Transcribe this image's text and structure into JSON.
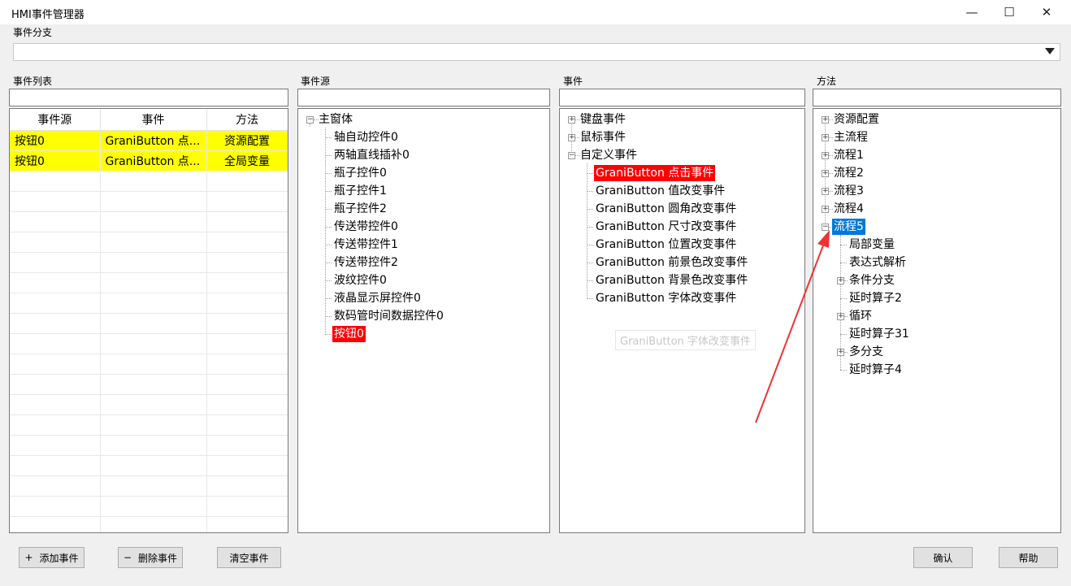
{
  "window": {
    "title": "HMI事件管理器",
    "minimize": "—",
    "maximize": "☐",
    "close": "✕"
  },
  "branch": {
    "label": "事件分支",
    "value": ""
  },
  "event_list": {
    "label": "事件列表",
    "columns": [
      "事件源",
      "事件",
      "方法"
    ],
    "rows": [
      {
        "source": "按钮0",
        "event": "GraniButton 点...",
        "method": "资源配置"
      },
      {
        "source": "按钮0",
        "event": "GraniButton 点...",
        "method": "全局变量"
      }
    ]
  },
  "event_source": {
    "label": "事件源",
    "root": "主窗体",
    "items": [
      "轴自动控件0",
      "两轴直线插补0",
      "瓶子控件0",
      "瓶子控件1",
      "瓶子控件2",
      "传送带控件0",
      "传送带控件1",
      "传送带控件2",
      "波纹控件0",
      "液晶显示屏控件0",
      "数码管时间数据控件0",
      "按钮0"
    ]
  },
  "events": {
    "label": "事件",
    "groups": [
      "键盘事件",
      "鼠标事件",
      "自定义事件"
    ],
    "custom_items": [
      "GraniButton 点击事件",
      "GraniButton 值改变事件",
      "GraniButton 圆角改变事件",
      "GraniButton 尺寸改变事件",
      "GraniButton 位置改变事件",
      "GraniButton 前景色改变事件",
      "GraniButton 背景色改变事件",
      "GraniButton 字体改变事件"
    ],
    "tooltip": "GraniButton 字体改变事件"
  },
  "methods": {
    "label": "方法",
    "top_items": [
      "资源配置",
      "主流程",
      "流程1",
      "流程2",
      "流程3",
      "流程4",
      "流程5"
    ],
    "sub_items": [
      "局部变量",
      "表达式解析",
      "条件分支",
      "延时算子2",
      "循环",
      "延时算子31",
      "多分支",
      "延时算子4"
    ]
  },
  "buttons": {
    "add": "添加事件",
    "add_icon": "+",
    "delete": "删除事件",
    "delete_icon": "−",
    "clear": "清空事件",
    "ok": "确认",
    "help": "帮助"
  },
  "colors": {
    "highlight_red": "#ff0000",
    "selected_blue": "#0078d7",
    "row_yellow": "#ffff00",
    "annotation_arrow": "#ee3333"
  }
}
